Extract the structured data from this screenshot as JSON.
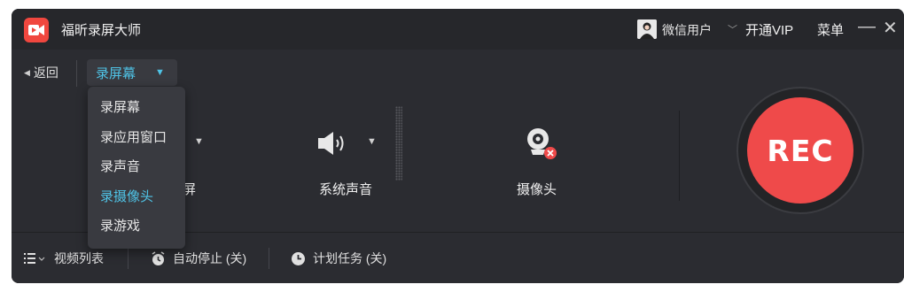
{
  "titlebar": {
    "app_title": "福昕录屏大师",
    "user_name": "微信用户",
    "vip_label": "开通VIP",
    "menu_label": "菜单",
    "minimize_glyph": "—",
    "close_glyph": "✕"
  },
  "toolbar": {
    "back_label": "返回",
    "mode_selected": "录屏幕"
  },
  "dropdown": {
    "items": [
      {
        "label": "录屏幕"
      },
      {
        "label": "录应用窗口"
      },
      {
        "label": "录声音"
      },
      {
        "label": "录摄像头",
        "active": true
      },
      {
        "label": "录游戏"
      }
    ]
  },
  "controls": {
    "screen_label_fragment": "屏",
    "system_audio_label": "系统声音",
    "camera_label": "摄像头",
    "rec_label": "REC"
  },
  "bottom_bar": {
    "video_list_label": "视频列表",
    "auto_stop_label": "自动停止 (关)",
    "schedule_label": "计划任务 (关)"
  },
  "colors": {
    "accent": "#4fc3e6",
    "rec": "#ef4a4a",
    "logo": "#f0473f",
    "window_bg": "#2b2c31"
  }
}
